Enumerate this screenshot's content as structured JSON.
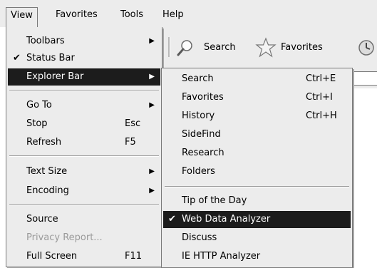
{
  "menubar": {
    "items": [
      "View",
      "Favorites",
      "Tools",
      "Help"
    ]
  },
  "toolbar": {
    "search_label": "Search",
    "favorites_label": "Favorites"
  },
  "view_menu": {
    "toolbars": "Toolbars",
    "status_bar": "Status Bar",
    "explorer_bar": "Explorer Bar",
    "go_to": "Go To",
    "stop": "Stop",
    "stop_shortcut": "Esc",
    "refresh": "Refresh",
    "refresh_shortcut": "F5",
    "text_size": "Text Size",
    "encoding": "Encoding",
    "source": "Source",
    "privacy_report": "Privacy Report...",
    "full_screen": "Full Screen",
    "full_screen_shortcut": "F11"
  },
  "explorer_menu": {
    "search": "Search",
    "search_shortcut": "Ctrl+E",
    "favorites": "Favorites",
    "favorites_shortcut": "Ctrl+I",
    "history": "History",
    "history_shortcut": "Ctrl+H",
    "sidefind": "SideFind",
    "research": "Research",
    "folders": "Folders",
    "tip_of_the_day": "Tip of the Day",
    "web_data_analyzer": "Web Data Analyzer",
    "discuss": "Discuss",
    "ie_http_analyzer": "IE HTTP Analyzer"
  },
  "icons": {
    "checkmark": "check-icon",
    "submenu_arrow": "submenu-arrow-icon"
  },
  "colors": {
    "menu_bg": "#ececec",
    "highlight_bg": "#1c1c1c",
    "highlight_text": "#ffffff",
    "disabled_text": "#9a9a9a"
  }
}
